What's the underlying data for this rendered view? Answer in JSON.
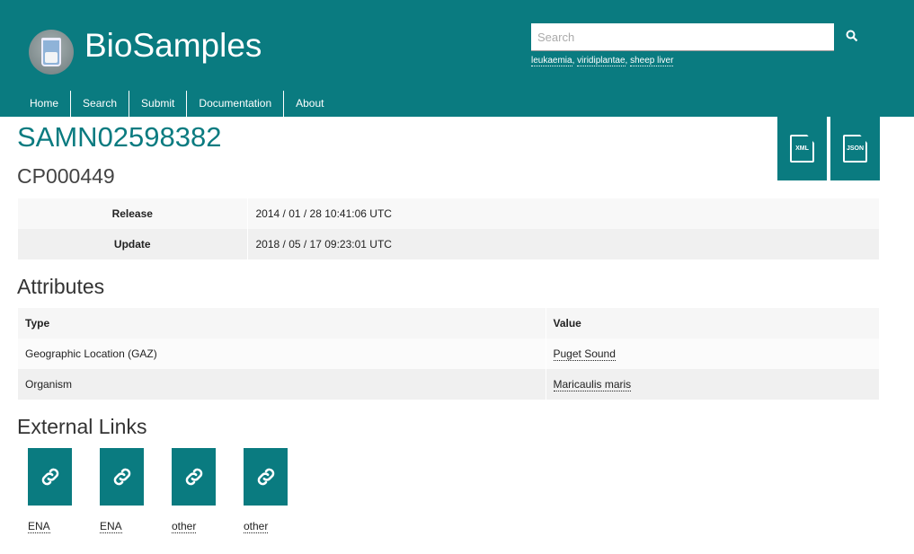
{
  "header": {
    "brand": "BioSamples",
    "search_placeholder": "Search",
    "examples": [
      "leukaemia",
      "viridiplantae",
      "sheep liver"
    ],
    "nav": [
      "Home",
      "Search",
      "Submit",
      "Documentation",
      "About"
    ]
  },
  "downloads": [
    "XML",
    "JSON"
  ],
  "sample": {
    "accession": "SAMN02598382",
    "name": "CP000449",
    "dates": [
      {
        "label": "Release",
        "value": "2014 / 01 / 28 10:41:06 UTC"
      },
      {
        "label": "Update",
        "value": "2018 / 05 / 17 09:23:01 UTC"
      }
    ]
  },
  "attributes": {
    "title": "Attributes",
    "headers": [
      "Type",
      "Value"
    ],
    "rows": [
      {
        "type": "Geographic Location (GAZ)",
        "value": "Puget Sound"
      },
      {
        "type": "Organism",
        "value": "Maricaulis maris"
      }
    ]
  },
  "external_links": {
    "title": "External Links",
    "items": [
      "ENA",
      "ENA",
      "other",
      "other"
    ]
  }
}
